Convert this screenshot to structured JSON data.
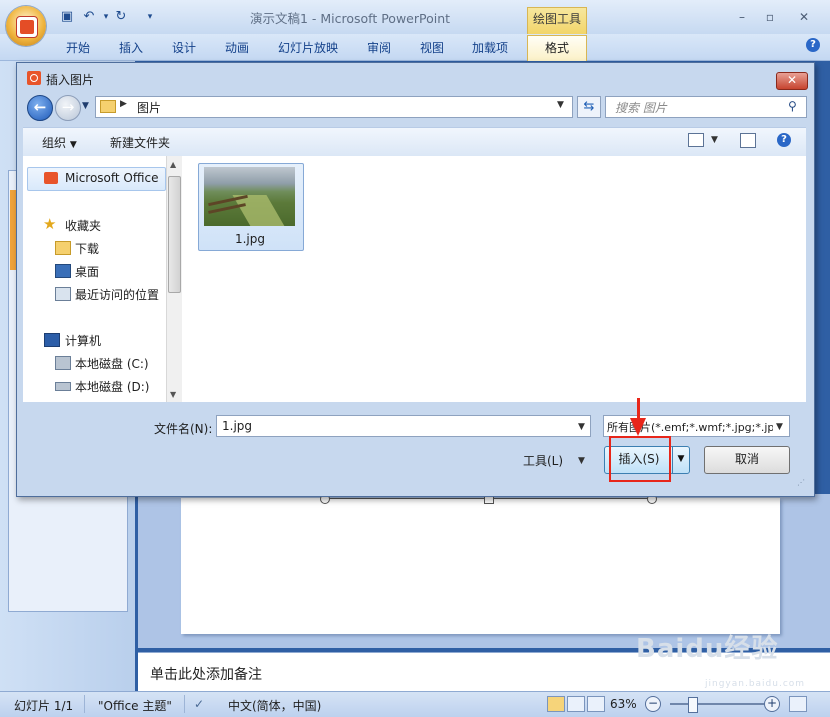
{
  "app": {
    "title": "演示文稿1 - Microsoft PowerPoint",
    "context_tab_group": "绘图工具",
    "ribbon_tabs": [
      "开始",
      "插入",
      "设计",
      "动画",
      "幻灯片放映",
      "审阅",
      "视图",
      "加载项",
      "格式"
    ],
    "active_tab": "格式"
  },
  "workspace": {
    "notes_placeholder": "单击此处添加备注",
    "watermark": "Baidu经验",
    "watermark_sub": "jingyan.baidu.com"
  },
  "statusbar": {
    "slide": "幻灯片 1/1",
    "theme": "\"Office 主题\"",
    "language": "中文(简体，中国)",
    "zoom": "63%"
  },
  "dialog": {
    "title": "插入图片",
    "address": {
      "path_segment": "图片"
    },
    "search": {
      "placeholder": "搜索 图片"
    },
    "toolbar": {
      "organize": "组织",
      "new_folder": "新建文件夹"
    },
    "nav": {
      "items": [
        {
          "label": "Microsoft Office",
          "icon": "office-icon"
        },
        {
          "label": "收藏夹",
          "icon": "star-icon"
        },
        {
          "label": "下载",
          "icon": "download-folder-icon"
        },
        {
          "label": "桌面",
          "icon": "desktop-icon"
        },
        {
          "label": "最近访问的位置",
          "icon": "recent-places-icon"
        },
        {
          "label": "计算机",
          "icon": "computer-icon"
        },
        {
          "label": "本地磁盘 (C:)",
          "icon": "drive-c-icon"
        },
        {
          "label": "本地磁盘 (D:)",
          "icon": "drive-d-icon"
        }
      ]
    },
    "files": [
      {
        "name": "1.jpg"
      }
    ],
    "filename": {
      "label": "文件名(N):",
      "value": "1.jpg"
    },
    "filetype": {
      "value": "所有图片(*.emf;*.wmf;*.jpg;*.jp"
    },
    "buttons": {
      "tools": "工具(L)",
      "insert": "插入(S)",
      "cancel": "取消"
    }
  },
  "colors": {
    "accent": "#2f5fa4",
    "highlight": "#e8261a",
    "context_tab": "#f2d56a"
  }
}
